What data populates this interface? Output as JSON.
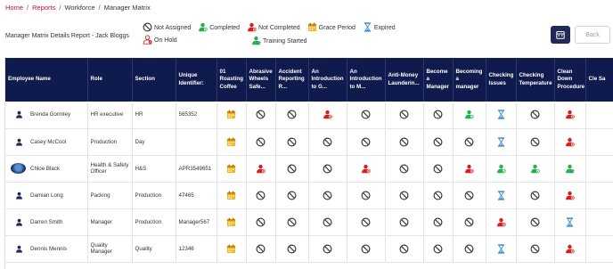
{
  "breadcrumb": [
    "Home",
    "Reports",
    "Workforce",
    "Manager Matrix"
  ],
  "separator": "/",
  "report_title": "Manager Matrix Details Report - Jack Bloggs",
  "legend": [
    {
      "label": "Not Assigned",
      "icon": "not-assigned"
    },
    {
      "label": "Completed",
      "icon": "completed"
    },
    {
      "label": "Not Completed",
      "icon": "not-completed"
    },
    {
      "label": "Grace Period",
      "icon": "grace-period"
    },
    {
      "label": "Expired",
      "icon": "expired"
    },
    {
      "label": "On Hold",
      "icon": "on-hold"
    },
    {
      "label": "Training Started",
      "icon": "training-started"
    }
  ],
  "buttons": {
    "back": "Back"
  },
  "colors": {
    "header": "#0f1b4c",
    "completed": "#22b14c",
    "not_completed": "#d91e1e",
    "grace": "#f0b429",
    "expired": "#3d8fd6",
    "not_assigned": "#3a3a3a",
    "breadcrumb_link": "#c8102e"
  },
  "columns": [
    "Employee Name",
    "Role",
    "Section",
    "Unique Identifier:",
    "01 Roasting Coffee",
    "Abrasive Wheels Safe...",
    "Accident Reporting R...",
    "An Introduction to G...",
    "An Introduction to M...",
    "Anti-Money Launderin...",
    "Become a Manager",
    "Becoming a manager",
    "Checking Issues",
    "Checking Temperature",
    "Clean Down Procedure",
    "Cle Sa"
  ],
  "rows": [
    {
      "name": "Brenda Gormley",
      "role": "HR executive",
      "section": "HR",
      "uid": "565352",
      "avatar": "person",
      "status": [
        "grace-period",
        "not-assigned",
        "not-assigned",
        "not-completed",
        "not-assigned",
        "not-assigned",
        "not-assigned",
        "completed",
        "expired",
        "not-assigned",
        "not-completed"
      ]
    },
    {
      "name": "Casey McCool",
      "role": "Production",
      "section": "Day",
      "uid": "",
      "avatar": "person",
      "status": [
        "grace-period",
        "not-assigned",
        "not-assigned",
        "not-assigned",
        "not-assigned",
        "not-assigned",
        "not-assigned",
        "not-assigned",
        "expired",
        "not-assigned",
        "not-completed"
      ]
    },
    {
      "name": "Chloe Black",
      "role": "Health & Safety Officer",
      "section": "H&S",
      "uid": "APR3549651",
      "avatar": "photo",
      "status": [
        "grace-period",
        "not-completed",
        "not-assigned",
        "not-assigned",
        "not-completed",
        "not-assigned",
        "not-assigned",
        "not-completed",
        "completed",
        "completed",
        "training-started"
      ]
    },
    {
      "name": "Damian Long",
      "role": "Packing",
      "section": "Production",
      "uid": "47465",
      "avatar": "person",
      "status": [
        "grace-period",
        "not-assigned",
        "not-assigned",
        "not-assigned",
        "not-assigned",
        "not-assigned",
        "not-assigned",
        "not-assigned",
        "expired",
        "not-assigned",
        "not-completed"
      ]
    },
    {
      "name": "Darren Smith",
      "role": "Manager",
      "section": "Production",
      "uid": "Manager567",
      "avatar": "person",
      "status": [
        "grace-period",
        "not-assigned",
        "not-assigned",
        "not-assigned",
        "not-assigned",
        "not-assigned",
        "not-assigned",
        "not-assigned",
        "not-completed",
        "not-assigned",
        "expired"
      ]
    },
    {
      "name": "Dennis Mennis",
      "role": "Quality Manager",
      "section": "Quality",
      "uid": "12346",
      "avatar": "person",
      "status": [
        "grace-period",
        "not-assigned",
        "not-assigned",
        "not-assigned",
        "not-assigned",
        "not-assigned",
        "not-assigned",
        "not-assigned",
        "expired",
        "not-assigned",
        "not-completed"
      ]
    }
  ]
}
